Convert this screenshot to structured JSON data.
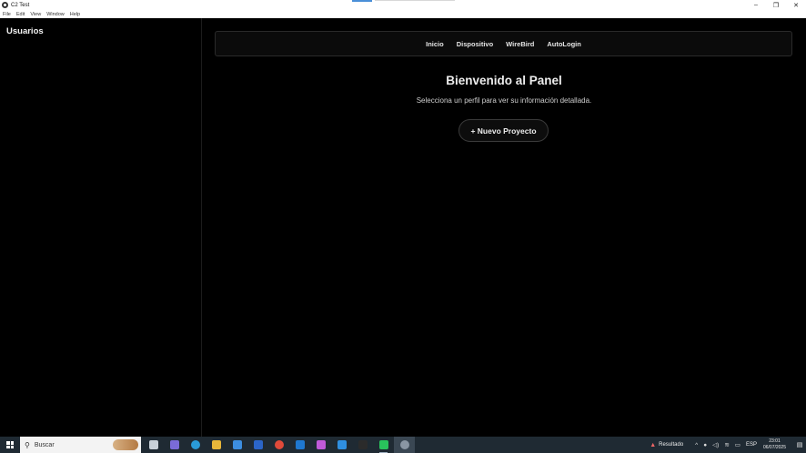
{
  "window": {
    "title": "C2 Test",
    "controls": {
      "minimize": "–",
      "restore": "❐",
      "close": "✕"
    }
  },
  "menu": [
    "File",
    "Edit",
    "View",
    "Window",
    "Help"
  ],
  "sidebar": {
    "title": "Usuarios"
  },
  "nav": {
    "links": [
      "Inicio",
      "Dispositivo",
      "WireBird",
      "AutoLogin"
    ]
  },
  "main": {
    "heading": "Bienvenido al Panel",
    "subtitle": "Selecciona un perfil para ver su información detallada.",
    "new_project_label": "+ Nuevo Proyecto"
  },
  "taskbar": {
    "search_placeholder": "Buscar",
    "apps": [
      {
        "name": "task-view-icon",
        "color": "#c9d1d9"
      },
      {
        "name": "copilot-icon",
        "color": "#7a6bd8"
      },
      {
        "name": "edge-icon",
        "color": "#2a9bd8"
      },
      {
        "name": "file-explorer-icon",
        "color": "#e8b73a"
      },
      {
        "name": "store-icon",
        "color": "#3d8ee0"
      },
      {
        "name": "word-icon",
        "color": "#2b65c8"
      },
      {
        "name": "chrome-icon",
        "color": "#e04a3a"
      },
      {
        "name": "outlook-icon",
        "color": "#1f78d0"
      },
      {
        "name": "app-icon",
        "color": "#c05ad8"
      },
      {
        "name": "vscode-icon",
        "color": "#2f8fe0"
      },
      {
        "name": "terminal-icon",
        "color": "#2b2b2b"
      },
      {
        "name": "whatsapp-icon",
        "color": "#29c25c"
      },
      {
        "name": "electron-app-icon",
        "color": "#8a96a3"
      }
    ],
    "weather_label": "Resultado",
    "language": "ESP",
    "time": "23:01",
    "date": "06/07/2025"
  }
}
